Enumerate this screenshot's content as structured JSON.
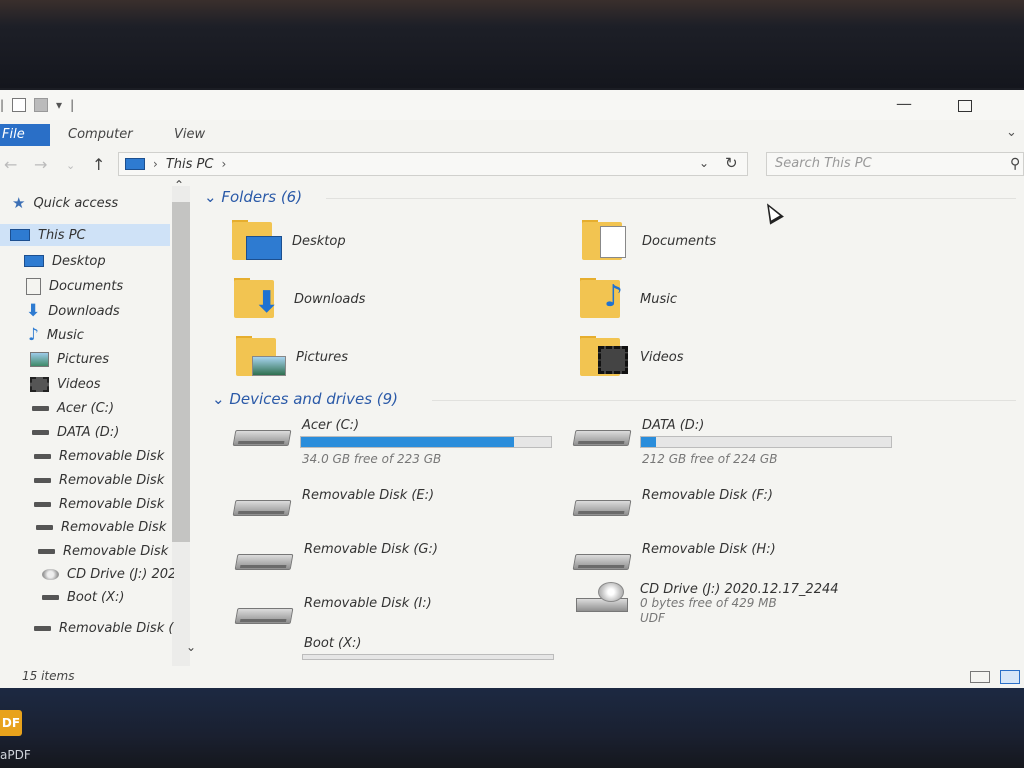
{
  "ribbon": {
    "tabs": [
      "File",
      "Computer",
      "View"
    ]
  },
  "address": {
    "path": "This PC",
    "search_placeholder": "Search This PC"
  },
  "sidebar": {
    "items": [
      {
        "label": "Quick access",
        "icon": "star-icon"
      },
      {
        "label": "This PC",
        "icon": "this-pc-icon"
      },
      {
        "label": "Desktop",
        "icon": "desktop-icon"
      },
      {
        "label": "Documents",
        "icon": "documents-icon"
      },
      {
        "label": "Downloads",
        "icon": "downloads-icon"
      },
      {
        "label": "Music",
        "icon": "music-icon"
      },
      {
        "label": "Pictures",
        "icon": "pictures-icon"
      },
      {
        "label": "Videos",
        "icon": "videos-icon"
      },
      {
        "label": "Acer (C:)",
        "icon": "drive-icon"
      },
      {
        "label": "DATA (D:)",
        "icon": "drive-icon"
      },
      {
        "label": "Removable Disk",
        "icon": "drive-icon"
      },
      {
        "label": "Removable Disk",
        "icon": "drive-icon"
      },
      {
        "label": "Removable Disk",
        "icon": "drive-icon"
      },
      {
        "label": "Removable Disk",
        "icon": "drive-icon"
      },
      {
        "label": "Removable Disk",
        "icon": "drive-icon"
      },
      {
        "label": "CD Drive (J:) 202",
        "icon": "cd-drive-icon"
      },
      {
        "label": "Boot (X:)",
        "icon": "drive-icon"
      },
      {
        "label": "Removable Disk (",
        "icon": "drive-icon"
      }
    ]
  },
  "folders": {
    "header": "Folders (6)",
    "items": [
      {
        "label": "Desktop",
        "icon": "desktop-folder-icon"
      },
      {
        "label": "Documents",
        "icon": "documents-folder-icon"
      },
      {
        "label": "Downloads",
        "icon": "downloads-folder-icon"
      },
      {
        "label": "Music",
        "icon": "music-folder-icon"
      },
      {
        "label": "Pictures",
        "icon": "pictures-folder-icon"
      },
      {
        "label": "Videos",
        "icon": "videos-folder-icon"
      }
    ]
  },
  "drives": {
    "header": "Devices and drives (9)",
    "items": [
      {
        "name": "Acer (C:)",
        "free": "34.0 GB free of 223 GB",
        "used_fraction": 0.85
      },
      {
        "name": "DATA (D:)",
        "free": "212 GB free of 224 GB",
        "used_fraction": 0.06
      },
      {
        "name": "Removable Disk (E:)"
      },
      {
        "name": "Removable Disk (F:)"
      },
      {
        "name": "Removable Disk (G:)"
      },
      {
        "name": "Removable Disk (H:)"
      },
      {
        "name": "Removable Disk (I:)"
      },
      {
        "name": "CD Drive (J:) 2020.12.17_2244",
        "free": "0 bytes free of 429 MB",
        "fs": "UDF"
      },
      {
        "name": "Boot (X:)"
      }
    ]
  },
  "status": {
    "items": "15 items"
  },
  "taskbar": {
    "badge": "DF",
    "caption": "aPDF"
  },
  "colors": {
    "accent": "#2a6fc7",
    "bar_fill": "#2a8ddb",
    "folder": "#f2c451",
    "header": "#2b5aa8"
  }
}
